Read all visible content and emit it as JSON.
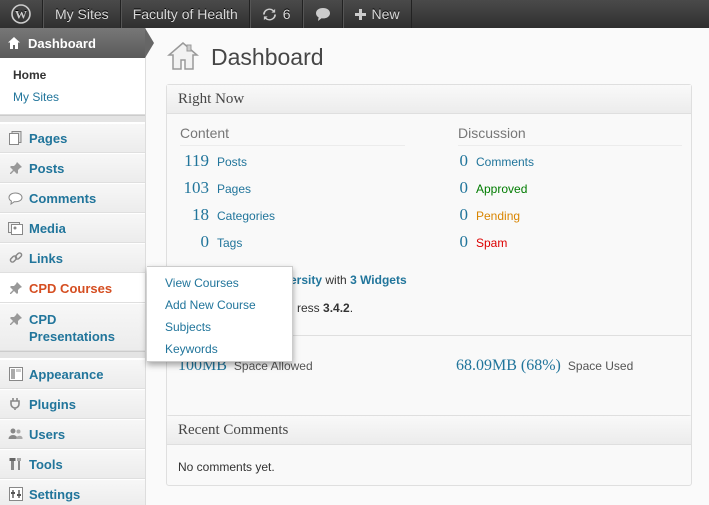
{
  "adminbar": {
    "wp_logo_icon": "wordpress-logo-icon",
    "my_sites": "My Sites",
    "site_name": "Faculty of Health",
    "updates_count": "6",
    "comments_icon": "speech-bubble-icon",
    "new_label": "New"
  },
  "sidebar": {
    "dashboard": "Dashboard",
    "dashboard_sub": [
      "Home",
      "My Sites"
    ],
    "items": [
      {
        "label": "Pages",
        "icon": "pages-icon"
      },
      {
        "label": "Posts",
        "icon": "pushpin-icon"
      },
      {
        "label": "Comments",
        "icon": "comment-icon"
      },
      {
        "label": "Media",
        "icon": "media-icon"
      },
      {
        "label": "Links",
        "icon": "link-icon"
      },
      {
        "label": "CPD Courses",
        "icon": "pushpin-icon"
      },
      {
        "label": "CPD Presentations",
        "icon": "pushpin-icon"
      },
      {
        "label": "Appearance",
        "icon": "appearance-icon"
      },
      {
        "label": "Plugins",
        "icon": "plugin-icon"
      },
      {
        "label": "Users",
        "icon": "users-icon"
      },
      {
        "label": "Tools",
        "icon": "tools-icon"
      },
      {
        "label": "Settings",
        "icon": "settings-icon"
      }
    ]
  },
  "flyout": {
    "items": [
      "View Courses",
      "Add New Course",
      "Subjects",
      "Keywords"
    ]
  },
  "main": {
    "title": "Dashboard",
    "right_now": {
      "heading": "Right Now",
      "content_heading": "Content",
      "discussion_heading": "Discussion",
      "content_rows": [
        {
          "count": "119",
          "label": "Posts"
        },
        {
          "count": "103",
          "label": "Pages"
        },
        {
          "count": "18",
          "label": "Categories"
        },
        {
          "count": "0",
          "label": "Tags"
        }
      ],
      "discussion_rows": [
        {
          "count": "0",
          "label": "Comments"
        },
        {
          "count": "0",
          "label": "Approved"
        },
        {
          "count": "0",
          "label": "Pending"
        },
        {
          "count": "0",
          "label": "Spam"
        }
      ],
      "theme_fragment": "ersity",
      "theme_with": "with",
      "widgets": "3 Widgets",
      "version_fragment": "ress",
      "version": "3.4.2",
      "version_period": ".",
      "space_allowed_value": "100MB",
      "space_allowed_label": "Space Allowed",
      "space_used_value": "68.09MB (68%)",
      "space_used_label": "Space Used"
    },
    "recent_comments": {
      "heading": "Recent Comments",
      "empty_text": "No comments yet."
    }
  },
  "colors": {
    "link": "#21759b",
    "approved": "#007c00",
    "pending": "#d98500",
    "spam": "#dd0000",
    "hover_menu": "#d54e21"
  }
}
